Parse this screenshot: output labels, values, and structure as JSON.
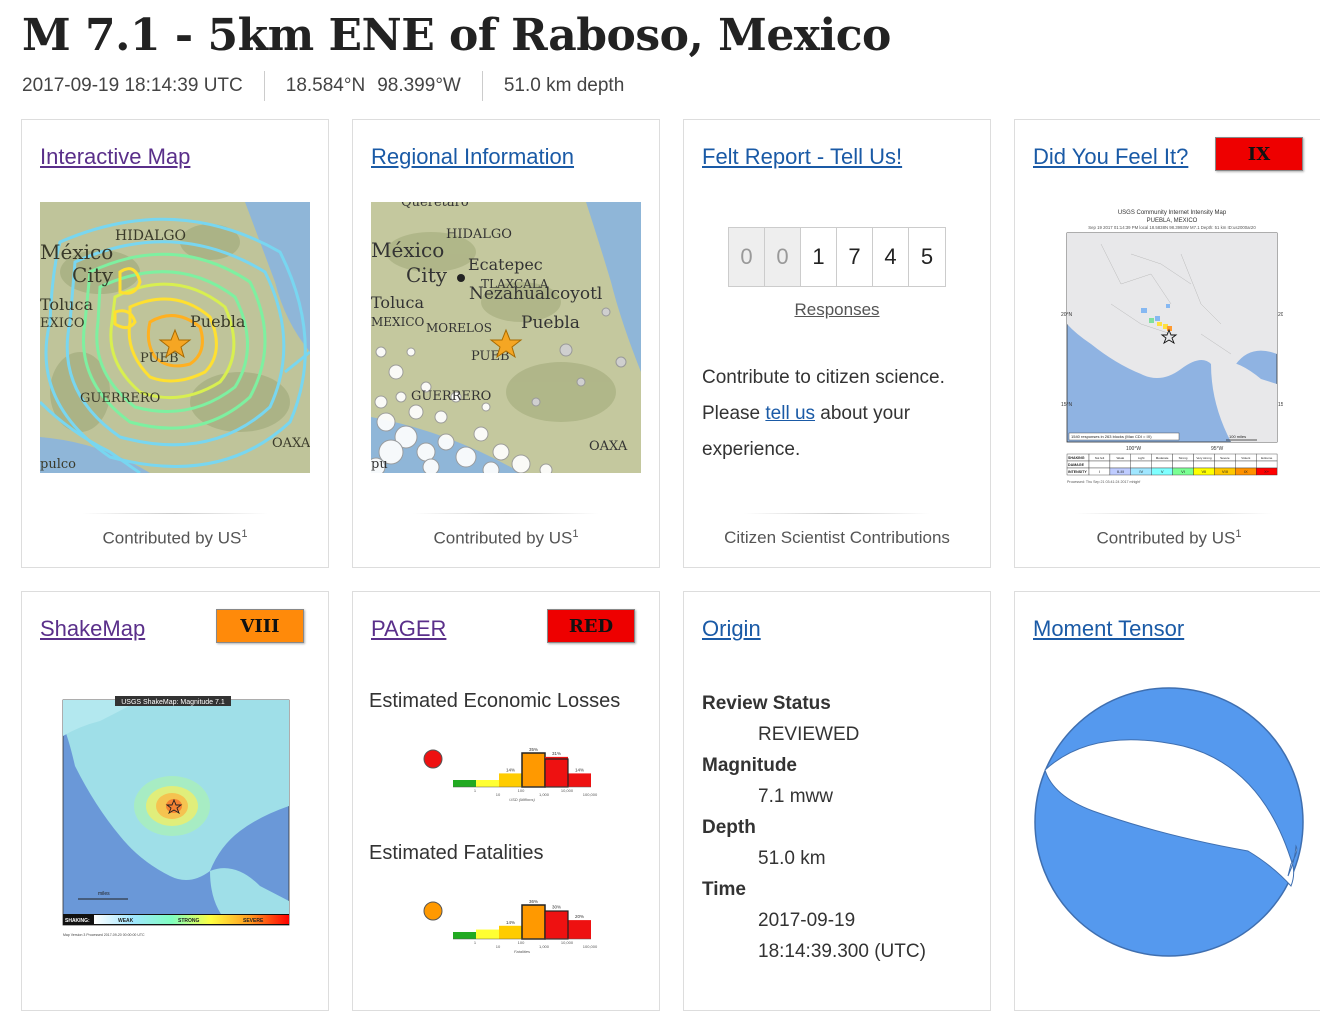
{
  "event": {
    "title": "M 7.1 - 5km ENE of Raboso, Mexico",
    "time": "2017-09-19 18:14:39 UTC",
    "latitude": "18.584°N",
    "longitude": "98.399°W",
    "depth": "51.0 km depth"
  },
  "cards": {
    "interactive_map": {
      "title": "Interactive Map",
      "footer": "Contributed by US",
      "sup": "1",
      "map_labels": [
        "HIDALGO",
        "México",
        "City",
        "Toluca",
        "EXICO",
        "Puebla",
        "PUEB",
        "GUERRERO",
        "pulco",
        "OAXA"
      ]
    },
    "regional": {
      "title": "Regional Information",
      "footer": "Contributed by US",
      "sup": "1",
      "map_labels": [
        "Querétaro",
        "HIDALGO",
        "México",
        "City",
        "Ecatepec",
        "TLAXCALA",
        "Nezahualcoyotl",
        "Toluca",
        "MEXICO",
        "MORELOS",
        "Puebla",
        "PUEB",
        "GUERRERO",
        "pu",
        "OAXA"
      ]
    },
    "felt_report": {
      "title": "Felt Report - Tell Us!",
      "digits": [
        "0",
        "0",
        "1",
        "7",
        "4",
        "5"
      ],
      "responses": "Responses",
      "text_before": "Contribute to citizen science. Please ",
      "link": "tell us",
      "text_after": " about your experience.",
      "footer": "Citizen Scientist Contributions"
    },
    "dyfi": {
      "title": "Did You Feel It?",
      "badge": "IX",
      "badge_color": "#ee0000",
      "footer": "Contributed by US",
      "sup": "1",
      "map_title": "USGS Community Internet Intensity Map",
      "map_subtitle": "PUEBLA, MEXICO",
      "map_caption": "Sep 19 2017 01:14:39 PM local 18.5838N 98.3993W M7.1 Depth: 51 km ID:us2000ar20",
      "lat_labels": [
        "20°N",
        "15°N"
      ],
      "lon_labels": [
        "100°W",
        "95°W"
      ],
      "stats": "1540 responses in 263 blocks (Max CDI = IX)",
      "scale_label": "100 miles",
      "processed": "Processed: Thu Sep 21 03:41:24 2017 mhighf",
      "legend_rows": [
        "SHAKING",
        "DAMAGE",
        "INTENSITY"
      ],
      "intensity_labels": [
        "I",
        "II-III",
        "IV",
        "V",
        "VI",
        "VII",
        "VIII",
        "IX",
        "X+"
      ],
      "shaking_labels": [
        "Not felt",
        "Weak",
        "Light",
        "Moderate",
        "Strong",
        "Very strong",
        "Severe",
        "Violent",
        "Extreme"
      ],
      "intensity_colors": [
        "#ffffff",
        "#bfccff",
        "#a0e6ff",
        "#80ffff",
        "#7aff93",
        "#ffff00",
        "#ffc800",
        "#ff9100",
        "#ff0000"
      ]
    },
    "shakemap": {
      "title": "ShakeMap",
      "badge": "VIII",
      "badge_color": "#ff8a0a",
      "map_title": "USGS ShakeMap: Magnitude 7.1",
      "scale_title": "miles",
      "shaking_label": "SHAKING:",
      "weak": "WEAK",
      "strong": "STRONG",
      "severe": "SEVERE",
      "caption": "Map Version 3 Processed 2017-09-20 00:00:00 UTC"
    },
    "pager": {
      "title": "PAGER",
      "badge": "RED",
      "badge_color": "#ee0000",
      "econ_label": "Estimated Economic Losses",
      "fatal_label": "Estimated Fatalities",
      "econ_color": "#ee1111",
      "fatal_color": "#ff9900",
      "econ_pcts": [
        1,
        5,
        14,
        35,
        31,
        14
      ],
      "econ_pct_labels": [
        "",
        "",
        "14%",
        "35%",
        "31%",
        "14%"
      ],
      "econ_ticks": [
        "1",
        "10",
        "100",
        "1,000",
        "10,000",
        "100,000"
      ],
      "econ_unit": "USD (Millions)",
      "fatal_pcts": [
        2,
        10,
        14,
        36,
        30,
        20
      ],
      "fatal_pct_labels": [
        "",
        "",
        "14%",
        "36%",
        "30%",
        "20%"
      ],
      "fatal_ticks": [
        "1",
        "10",
        "100",
        "1,000",
        "10,000",
        "100,000"
      ],
      "fatal_unit": "Fatalities"
    },
    "origin": {
      "title": "Origin",
      "rows": [
        {
          "label": "Review Status",
          "value": "REVIEWED"
        },
        {
          "label": "Magnitude",
          "value": "7.1 mww"
        },
        {
          "label": "Depth",
          "value": "51.0 km"
        },
        {
          "label": "Time",
          "value": "2017-09-19",
          "value2": "18:14:39.300 (UTC)"
        }
      ]
    },
    "moment_tensor": {
      "title": "Moment Tensor",
      "beachball_color": "#5599ee"
    }
  }
}
